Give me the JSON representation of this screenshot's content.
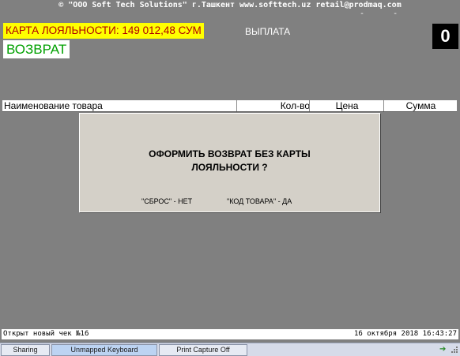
{
  "header": {
    "copyright": "© \"OOO Soft Tech Solutions\" г.Ташкент www.softtech.uz retail@prodmaq.com",
    "dashes": "-      -"
  },
  "loyalty": {
    "text": "КАРТА ЛОЯЛЬНОСТИ: 149 012,48 СУМ"
  },
  "mode": {
    "label": "ВЫПЛАТА"
  },
  "counter": {
    "value": "0"
  },
  "operation": {
    "label": "ВОЗВРАТ"
  },
  "table": {
    "columns": [
      "Наименование товара",
      "Кол-во",
      "Цена",
      "Сумма"
    ]
  },
  "dialog": {
    "message_line1": "ОФОРМИТЬ ВОЗВРАТ БЕЗ КАРТЫ",
    "message_line2": "ЛОЯЛЬНОСТИ ?",
    "no_option": "\"СБРОС\" - НЕТ",
    "yes_option": "\"КОД ТОВАРА\" - ДА"
  },
  "status": {
    "left": "Открыт новый чек №16",
    "right": "16 октября 2018 16:43:27"
  },
  "taskbar": {
    "sharing": "Sharing",
    "keyboard": "Unmapped Keyboard",
    "capture": "Print Capture Off"
  },
  "colors": {
    "background": "#808080",
    "loyalty_bg": "#ffff00",
    "loyalty_text": "#b00000",
    "return_text": "#00a000",
    "dialog_bg": "#d4d0c8"
  }
}
